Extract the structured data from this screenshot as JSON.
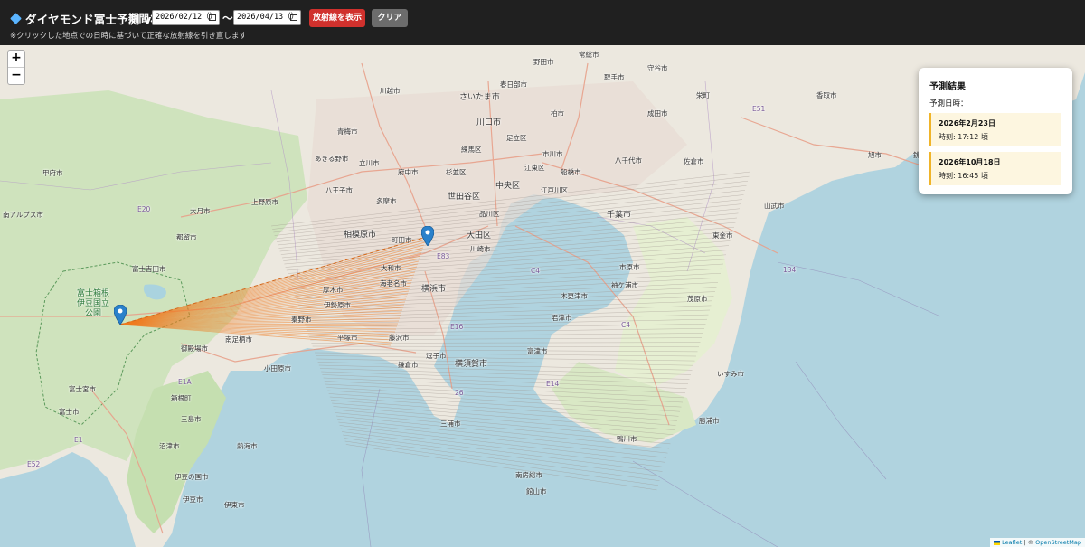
{
  "app": {
    "title": "ダイヤモンド富士予測 v3",
    "gem_icon_color": "#5ab4ff"
  },
  "toolbar": {
    "period_label": "期間：",
    "start_date": "2026/02/12（）",
    "tilde": "〜",
    "end_date": "2026/04/13（）",
    "show_rays_label": "放射線を表示",
    "clear_label": "クリア",
    "hint": "※クリックした地点での日時に基づいて正確な放射線を引き直します",
    "show_rays_color": "#d0312d",
    "clear_color": "#6c6c6c"
  },
  "map": {
    "zoom_in": "+",
    "zoom_out": "−",
    "labels": {
      "kawagoe": "川越市",
      "saitama": "さいたま市",
      "kawaguchi": "川口市",
      "adachi": "足立区",
      "ichikawa": "市川市",
      "funabashi": "船橋市",
      "chiba": "千葉市",
      "nerima": "練馬区",
      "suginami": "杉並区",
      "setagaya": "世田谷区",
      "shinagawa": "品川区",
      "ota": "大田区",
      "kawasaki": "川崎市",
      "yokohama": "横浜市",
      "hachioji": "八王子市",
      "tachikawa": "立川市",
      "fuchu": "府中市",
      "sagamihara": "相模原市",
      "atsugi": "厚木市",
      "ebina": "海老名市",
      "odawara": "小田原市",
      "hiratsuka": "平塚市",
      "fujisawa": "藤沢市",
      "zushi": "逗子市",
      "yokosuka": "横須賀市",
      "miura": "三浦市",
      "kisarazu": "木更津市",
      "kimitsu": "君津市",
      "futtsu": "富津市",
      "tateyama": "館山市",
      "minamiboso": "南房総市",
      "kamogawa": "鴨川市",
      "katsuura": "勝浦市",
      "isumi": "いすみ市",
      "mobara": "茂原市",
      "ichihara": "市原市",
      "togane": "東金市",
      "narita": "成田市",
      "sakura": "佐倉市",
      "kashiwa": "柏市",
      "noda": "野田市",
      "kasukabe": "春日部市",
      "choshi": "銚子市",
      "asahi": "旭市",
      "sanmu": "山武市",
      "kofu": "甲府市",
      "tsuru": "都留市",
      "otsuki": "大月市",
      "uenohara": "上野原市",
      "fujiyoshida": "富士吉田市",
      "gotemba": "御殿場市",
      "fuji": "富士市",
      "numazu": "沼津市",
      "mishima": "三島市",
      "atami": "熱海市",
      "ito": "伊東市",
      "izu": "伊豆市",
      "izunokuni": "伊豆の国市",
      "minami_alps": "南アルプス市",
      "fujinomiya": "富士宮市",
      "hakone": "箱根町",
      "minamiashigara": "南足柄市",
      "hadano": "秦野市",
      "isehara": "伊勢原市",
      "yamato": "大和市",
      "machida": "町田市",
      "tama": "多摩市",
      "ome": "青梅市",
      "akiruno": "あきる野市",
      "chuo": "中央区",
      "koto": "江東区",
      "edogawa": "江戸川区",
      "yachiyo": "八千代市",
      "sodegaura": "袖ケ浦市",
      "kamakura": "鎌倉市",
      "park": "富士箱根\n伊豆国立\n公園",
      "joso": "常総市",
      "toride": "取手市",
      "moriya": "守谷市",
      "sakae": "栄町",
      "katori": "香取市",
      "e51": "E51",
      "e20": "E20",
      "e1": "E1",
      "e1a": "E1A",
      "e52": "E52",
      "e14": "E14",
      "e16": "E16",
      "c4": "C4",
      "c4b": "C4",
      "e83": "E83",
      "n26": "26",
      "road_134": "134"
    }
  },
  "results": {
    "title": "予測結果",
    "subtitle": "予測日時：",
    "items": [
      {
        "date": "2026年2月23日",
        "time": "時刻: 17:12 頃"
      },
      {
        "date": "2026年10月18日",
        "time": "時刻: 16:45 頃"
      }
    ],
    "accent_color": "#f0b429"
  },
  "attribution": {
    "leaflet": "Leaflet",
    "separator": " | © ",
    "osm": "OpenStreetMap"
  }
}
